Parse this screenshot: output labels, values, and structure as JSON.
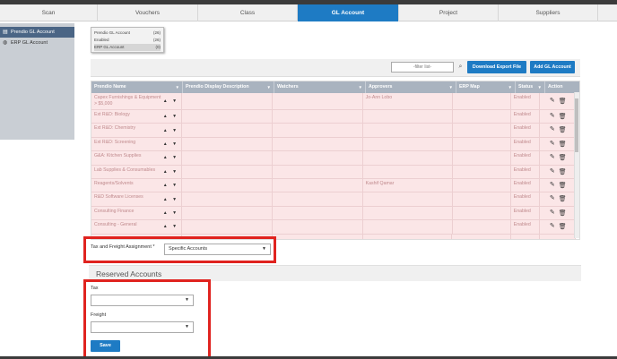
{
  "tabs": [
    {
      "label": "Scan",
      "active": false
    },
    {
      "label": "Vouchers",
      "active": false
    },
    {
      "label": "Class",
      "active": false
    },
    {
      "label": "GL Account",
      "active": true
    },
    {
      "label": "Project",
      "active": false
    },
    {
      "label": "Suppliers",
      "active": false
    }
  ],
  "sidebar": {
    "items": [
      {
        "label": "Prendio GL Account",
        "icon": "document-icon",
        "active": true
      },
      {
        "label": "ERP GL Account",
        "icon": "globe-icon",
        "active": false
      }
    ]
  },
  "filter_panel": {
    "rows": [
      {
        "label": "Prendio GL Account",
        "count": "(26)"
      },
      {
        "label": "Enabled",
        "count": "(26)"
      },
      {
        "label": "ERP GL Account",
        "count": "(0)"
      }
    ]
  },
  "toolbar": {
    "filter_placeholder": "-filter list-",
    "download_label": "Download Export File",
    "add_label": "Add GL Account"
  },
  "table": {
    "headers": [
      "Prendio Name",
      "Prendio Display Description",
      "Watchers",
      "Approvers",
      "ERP Map",
      "Status",
      "Action"
    ],
    "rows": [
      {
        "name": "Capex Furnishings & Equipment > $5,000",
        "approver": "Jo-Ann Lobo",
        "status": "Enabled"
      },
      {
        "name": "Ext R&D: Biology",
        "approver": "",
        "status": "Enabled"
      },
      {
        "name": "Ext R&D: Chemistry",
        "approver": "",
        "status": "Enabled"
      },
      {
        "name": "Ext R&D: Screening",
        "approver": "",
        "status": "Enabled"
      },
      {
        "name": "G&A: Kitchen Supplies",
        "approver": "",
        "status": "Enabled"
      },
      {
        "name": "Lab Supplies & Consumables",
        "approver": "",
        "status": "Enabled"
      },
      {
        "name": "Reagents/Solvents",
        "approver": "Kashif Qamar",
        "status": "Enabled"
      },
      {
        "name": "R&D Software Licenses",
        "approver": "",
        "status": "Enabled"
      },
      {
        "name": "Consulting Finance",
        "approver": "",
        "status": "Enabled"
      },
      {
        "name": "Consulting - General",
        "approver": "",
        "status": "Enabled"
      }
    ]
  },
  "tax_freight": {
    "label": "Tax and Freight Assignment *",
    "value": "Specific Accounts"
  },
  "reserved": {
    "title": "Reserved Accounts",
    "tax_label": "Tax",
    "tax_value": "",
    "freight_label": "Freight",
    "freight_value": "",
    "save_label": "Save"
  },
  "colors": {
    "accent": "#1e7bc4",
    "highlight_border": "#e0231f",
    "row_bg": "#fbe6e7"
  }
}
